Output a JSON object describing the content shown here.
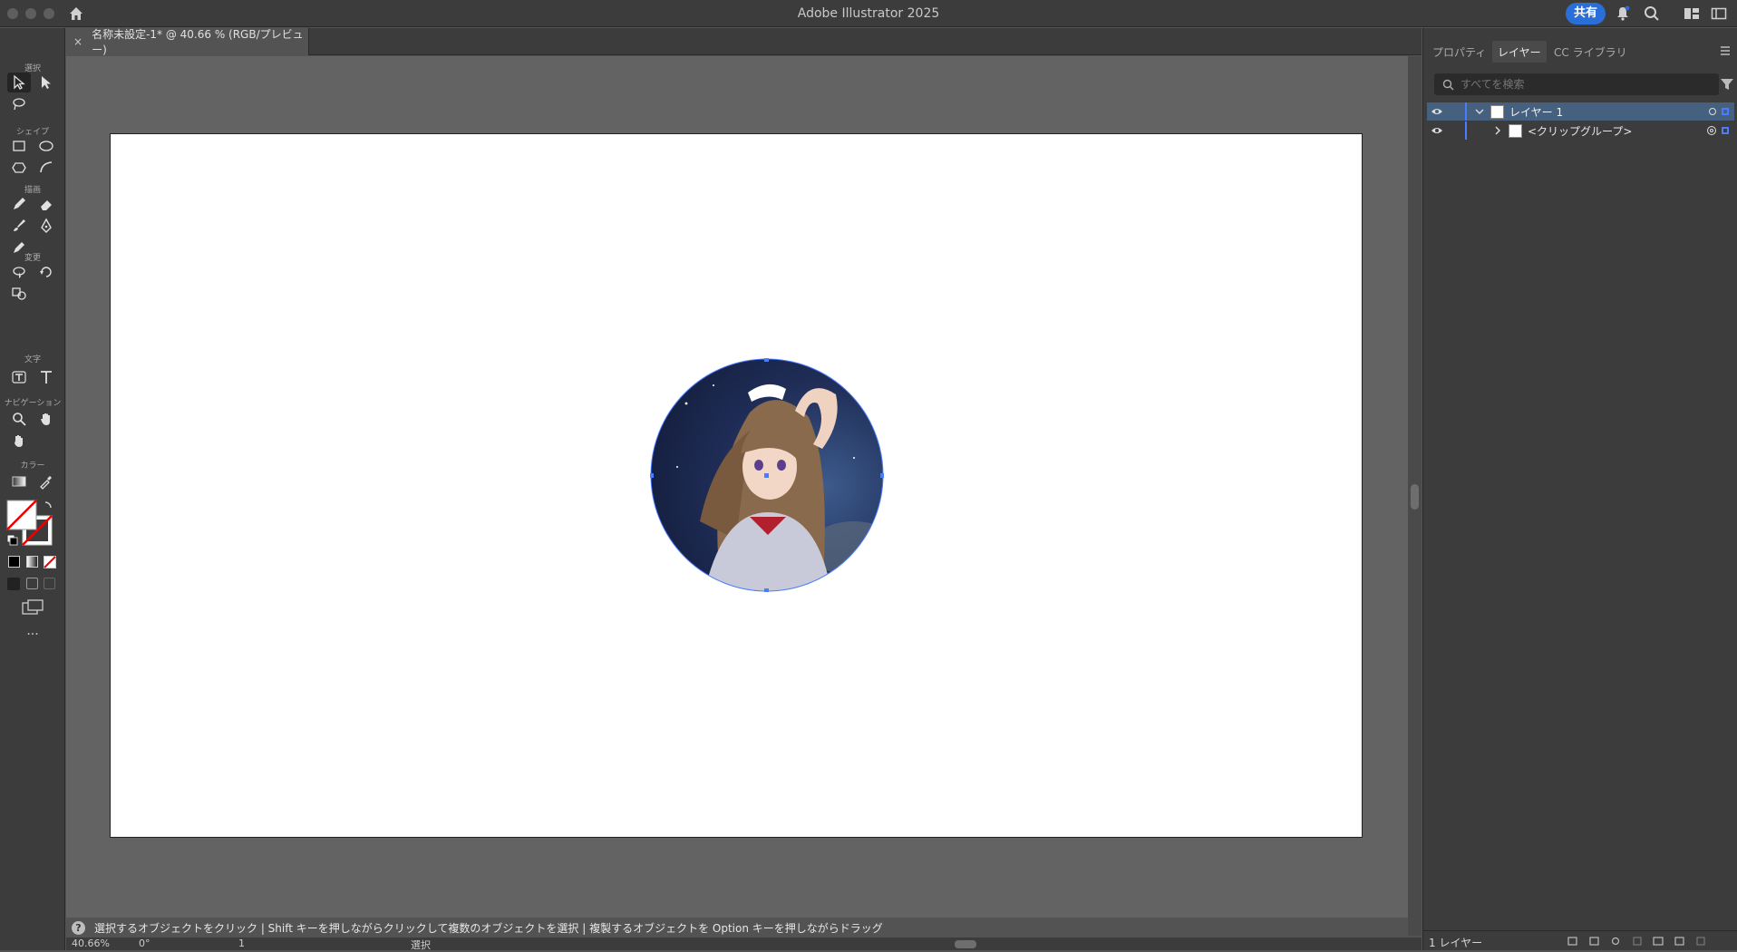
{
  "app": {
    "title": "Adobe Illustrator 2025",
    "share_label": "共有"
  },
  "document": {
    "tab_label": "名称未設定-1* @ 40.66 % (RGB/プレビュー)",
    "close_glyph": "×"
  },
  "toolbar": {
    "groups": [
      "選択",
      "シェイプ",
      "描画",
      "変更",
      "文字",
      "ナビゲーション",
      "カラー"
    ],
    "more_label": "..."
  },
  "status": {
    "help_glyph": "?",
    "hint": "選択するオブジェクトをクリック | Shift キーを押しながらクリックして複数のオブジェクトを選択 | 複製するオブジェクトを Option キーを押しながらドラッグ",
    "zoom": "40.66%",
    "rotation": "0°",
    "artboard_number": "1",
    "tool_name": "選択"
  },
  "panel": {
    "tabs": [
      "プロパティ",
      "レイヤー",
      "CC ライブラリ"
    ],
    "active_tab": "レイヤー",
    "search_placeholder": "すべてを検索",
    "layers": [
      {
        "name": "レイヤー 1",
        "expanded": true,
        "selected": true
      },
      {
        "name": "<クリップグループ>",
        "expanded": false,
        "selected": false
      }
    ],
    "footer_count": "1 レイヤー"
  },
  "colors": {
    "accent": "#2a6fd8",
    "selection": "#4a7cff",
    "layer_selected": "#46607f"
  }
}
